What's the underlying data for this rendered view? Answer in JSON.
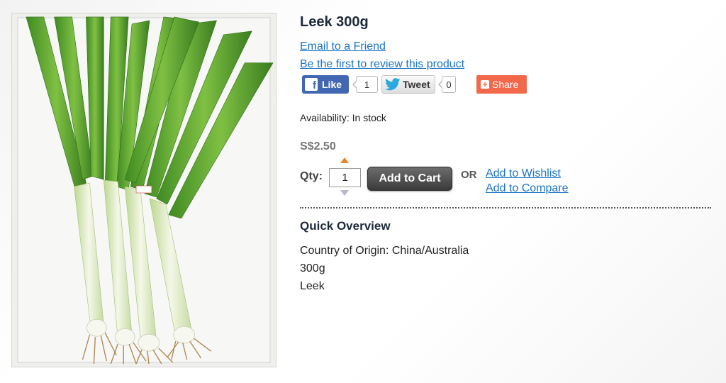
{
  "product": {
    "title": "Leek 300g",
    "image_alt": "Leek",
    "email_link": "Email to a Friend",
    "review_link": "Be the first to review this product",
    "availability": "Availability: In stock",
    "price": "S$2.50"
  },
  "social": {
    "fb_like_label": "Like",
    "fb_count": "1",
    "tweet_label": "Tweet",
    "tweet_count": "0",
    "share_label": "Share"
  },
  "cart": {
    "qty_label": "Qty:",
    "qty_value": "1",
    "add_to_cart_label": "Add to Cart",
    "or_label": "OR",
    "wishlist_link": "Add to Wishlist",
    "compare_link": "Add to Compare"
  },
  "overview": {
    "title": "Quick Overview",
    "lines": [
      "Country of Origin: China/Australia",
      "300g",
      "Leek"
    ]
  },
  "colors": {
    "link": "#1b74c5",
    "facebook": "#4267b2",
    "share": "#f2684a",
    "qty_up_arrow": "#e8832b",
    "title": "#1e2a3a"
  },
  "icons": {
    "fb": "facebook-icon",
    "tw": "twitter-bird-icon",
    "share": "plus-icon"
  }
}
